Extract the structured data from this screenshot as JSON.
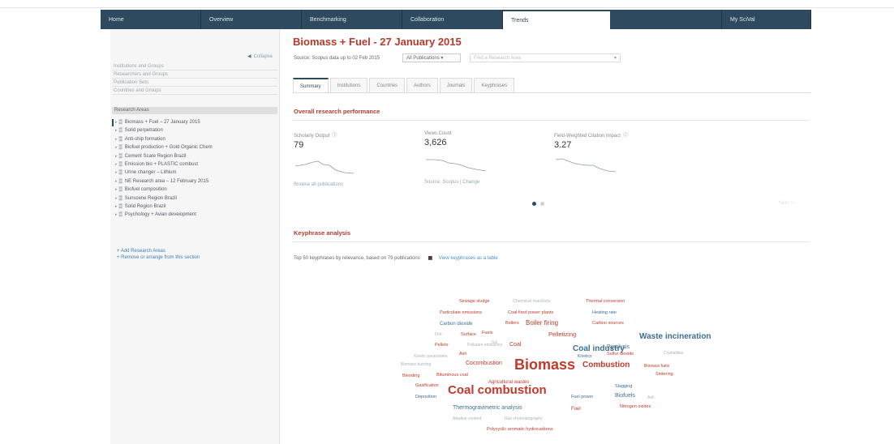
{
  "nav": {
    "tabs": [
      {
        "label": "Home",
        "width": 124
      },
      {
        "label": "Overview",
        "width": 124
      },
      {
        "label": "Benchmarking",
        "width": 124
      },
      {
        "label": "Collaboration",
        "width": 124
      },
      {
        "label": "Trends",
        "width": 132
      },
      {
        "label": "",
        "width": 138
      },
      {
        "label": "My SciVal",
        "width": 110
      }
    ],
    "active_index": 4
  },
  "sidebar": {
    "collapse_label": "Collapse",
    "menu": [
      "Institutions and Groups",
      "Researchers and Groups",
      "Publication Sets",
      "Countries and Groups"
    ],
    "header": "Research Areas",
    "sets": [
      "Biomass + Fuel – 27 January 2015",
      "Solid perpetration",
      "Anti-ship formation",
      "Biofuel production + Gold Organic Chem",
      "Cement Scare Region Brazil",
      "Emission bio + PLASTIC combust",
      "Urine changer – Lithium",
      "NE Research area – 12 February 2015",
      "Biofuel composition",
      "Sunscene Region Brazil",
      "Solid Region Brazil",
      "Psychology + Avian development"
    ],
    "links": [
      "+ Add Research Areas",
      "+ Remove or arrange from this section"
    ]
  },
  "header": {
    "title": "Biomass + Fuel - 27 January 2015",
    "source": "Source: Scopus data up to 02 Feb 2015",
    "pub_select": "All Publications ▾",
    "search_placeholder": "Find a Research Area"
  },
  "tabs": [
    "Summary",
    "Institutions",
    "Countries",
    "Authors",
    "Journals",
    "Keyphrases"
  ],
  "overall": {
    "title": "Overall research performance",
    "metrics": [
      {
        "label": "Scholarly Output",
        "value": "79",
        "link": "Browse all publications"
      },
      {
        "label": "Views Count",
        "value": "3,626",
        "link": "Source: Scopus | Change"
      },
      {
        "label": "Field-Weighted Citation Impact",
        "value": "3.27",
        "link": ""
      }
    ],
    "pager_next": "Next >"
  },
  "keyphrase": {
    "title": "Keyphrase analysis",
    "summary": "Top 50 keyphrases by relevance, based on 79 publications",
    "link": "View keyphrases as a table",
    "icon": "bar-chart-icon",
    "words": [
      {
        "t": "Sewage sludge",
        "c": "r",
        "s": 5.5
      },
      {
        "t": "Chemical reactions",
        "c": "g",
        "s": 5.5
      },
      {
        "t": "Thermal conversion",
        "c": "r",
        "s": 5.5
      },
      {
        "t": "Particulate emissions",
        "c": "r",
        "s": 5.5
      },
      {
        "t": "Coal fired power plants",
        "c": "r",
        "s": 5.5
      },
      {
        "t": "Heating rate",
        "c": "b",
        "s": 5.5
      },
      {
        "t": "Carbon dioxide",
        "c": "b",
        "s": 6
      },
      {
        "t": "Boilers",
        "c": "r",
        "s": 5.5
      },
      {
        "t": "Boiler firing",
        "c": "r",
        "s": 8
      },
      {
        "t": "Carbon sources",
        "c": "r",
        "s": 5.5
      },
      {
        "t": "Fire",
        "c": "g",
        "s": 5
      },
      {
        "t": "Surface",
        "c": "r",
        "s": 5.5
      },
      {
        "t": "Fuels",
        "c": "r",
        "s": 5.5
      },
      {
        "t": "Pelletizing",
        "c": "r",
        "s": 7.5
      },
      {
        "t": "Waste incineration",
        "c": "b",
        "s": 10
      },
      {
        "t": "Pellets",
        "c": "r",
        "s": 5.5
      },
      {
        "t": "Pollutant emissions",
        "c": "g",
        "s": 5
      },
      {
        "t": "Sol",
        "c": "g",
        "s": 5
      },
      {
        "t": "Coal",
        "c": "r",
        "s": 7
      },
      {
        "t": "Coal industry",
        "c": "b",
        "s": 10
      },
      {
        "t": "Pyrolysis",
        "c": "b",
        "s": 7
      },
      {
        "t": "Kinetic parameters",
        "c": "g",
        "s": 5
      },
      {
        "t": "Ash",
        "c": "r",
        "s": 5.5
      },
      {
        "t": "Kinetics",
        "c": "b",
        "s": 5
      },
      {
        "t": "Sulfur dioxide",
        "c": "r",
        "s": 5.5
      },
      {
        "t": "Crystallites",
        "c": "g",
        "s": 5
      },
      {
        "t": "Biomass burning",
        "c": "g",
        "s": 5
      },
      {
        "t": "Cocombustion",
        "c": "r",
        "s": 7
      },
      {
        "t": "Biomass",
        "c": "r",
        "s": 18
      },
      {
        "t": "Combustion",
        "c": "r",
        "s": 10
      },
      {
        "t": "Biomass fuels",
        "c": "r",
        "s": 5
      },
      {
        "t": "Blending",
        "c": "r",
        "s": 5.5
      },
      {
        "t": "Bituminous coal",
        "c": "r",
        "s": 5.5
      },
      {
        "t": "Sintering",
        "c": "r",
        "s": 5.5
      },
      {
        "t": "Gasification",
        "c": "r",
        "s": 5.5
      },
      {
        "t": "Coal combustion",
        "c": "r",
        "s": 15
      },
      {
        "t": "Agricultural wastes",
        "c": "r",
        "s": 6
      },
      {
        "t": "Slagging",
        "c": "b",
        "s": 5.5
      },
      {
        "t": "Deposition",
        "c": "b",
        "s": 5.5
      },
      {
        "t": "Fuel power",
        "c": "b",
        "s": 5.5
      },
      {
        "t": "Biofuels",
        "c": "b",
        "s": 7
      },
      {
        "t": "Ash",
        "c": "g",
        "s": 5
      },
      {
        "t": "Thermogravimetric analysis",
        "c": "b",
        "s": 7
      },
      {
        "t": "Fuel",
        "c": "r",
        "s": 6
      },
      {
        "t": "Nitrogen oxides",
        "c": "r",
        "s": 5.5
      },
      {
        "t": "Alkaline content",
        "c": "g",
        "s": 5
      },
      {
        "t": "Gas chromatography",
        "c": "g",
        "s": 5
      },
      {
        "t": "Polycyclic aromatic hydrocarbons",
        "c": "r",
        "s": 5.5
      }
    ]
  }
}
